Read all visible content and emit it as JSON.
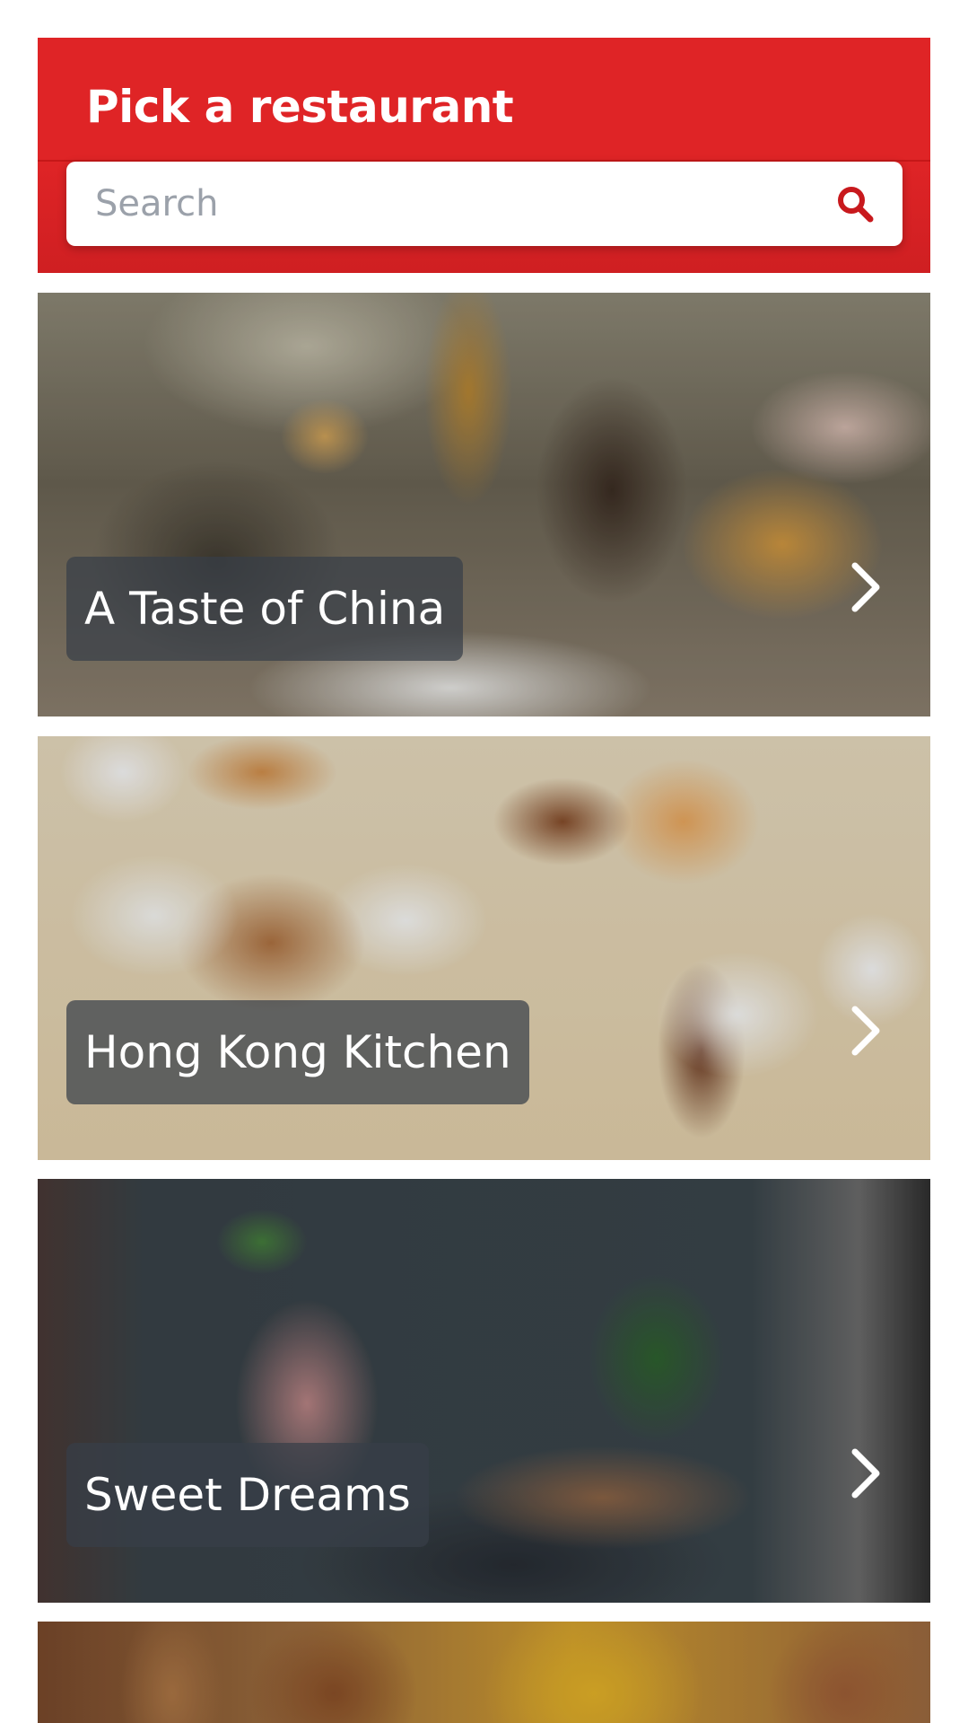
{
  "header": {
    "title": "Pick a restaurant",
    "search_placeholder": "Search",
    "search_value": "",
    "search_icon": "search-icon",
    "color": "#df2426"
  },
  "restaurants": [
    {
      "name": "A Taste of China",
      "icon": "chevron-right-icon"
    },
    {
      "name": "Hong Kong Kitchen",
      "icon": "chevron-right-icon"
    },
    {
      "name": "Sweet Dreams",
      "icon": "chevron-right-icon"
    },
    {
      "name": "",
      "icon": "chevron-right-icon"
    }
  ]
}
